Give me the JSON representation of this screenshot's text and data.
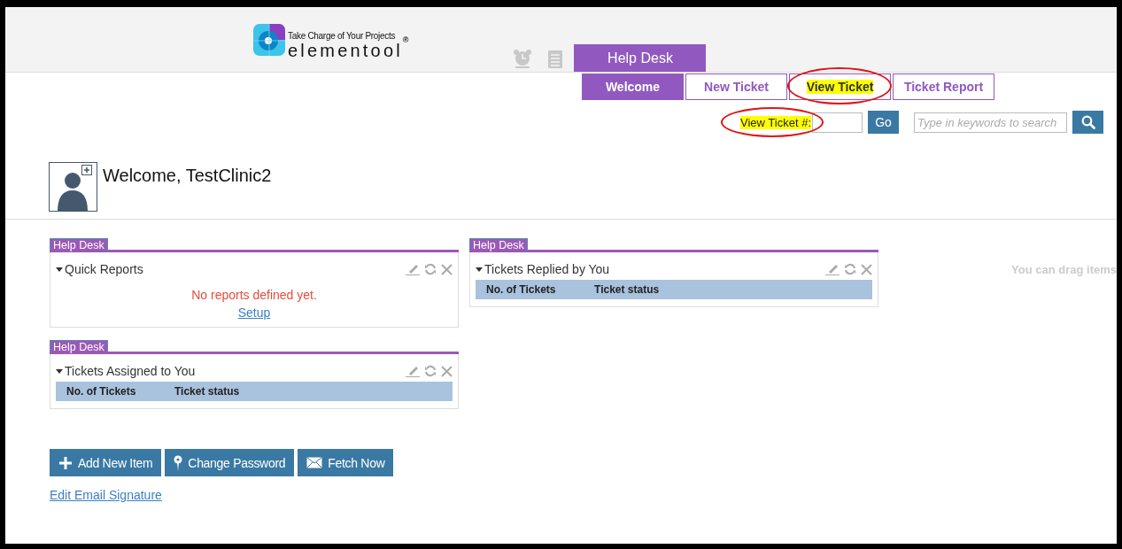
{
  "header": {
    "logo_tagline": "Take Charge of Your Projects",
    "logo_name": "elementool",
    "logo_mark": "®",
    "module_tab": "Help Desk"
  },
  "tabs": [
    {
      "label": "Welcome",
      "selected": true,
      "highlighted": false,
      "circled": false
    },
    {
      "label": "New Ticket",
      "selected": false,
      "highlighted": false,
      "circled": false
    },
    {
      "label": "View Ticket",
      "selected": false,
      "highlighted": true,
      "circled": true
    },
    {
      "label": "Ticket Report",
      "selected": false,
      "highlighted": false,
      "circled": false
    }
  ],
  "ticket_lookup": {
    "label": "View Ticket #:",
    "highlighted": true,
    "circled": true,
    "button": "Go"
  },
  "search": {
    "placeholder": "Type in keywords to search"
  },
  "welcome": "Welcome, TestClinic2",
  "columns": [
    {
      "widgets": [
        {
          "tag": "Help Desk",
          "title": "Quick Reports",
          "kind": "message",
          "message": "No reports defined yet.",
          "link": "Setup"
        },
        {
          "tag": "Help Desk",
          "title": "Tickets Assigned to You",
          "kind": "table",
          "columns": [
            "No. of Tickets",
            "Ticket status"
          ]
        }
      ]
    },
    {
      "widgets": [
        {
          "tag": "Help Desk",
          "title": "Tickets Replied by You",
          "kind": "table",
          "columns": [
            "No. of Tickets",
            "Ticket status"
          ]
        }
      ]
    }
  ],
  "drag_hint": "You can drag items",
  "buttons": [
    {
      "label": "Add New Item",
      "kind": "add"
    },
    {
      "label": "Change Password",
      "kind": "password"
    },
    {
      "label": "Fetch Now",
      "kind": "fetch"
    }
  ],
  "link": "Edit Email Signature"
}
